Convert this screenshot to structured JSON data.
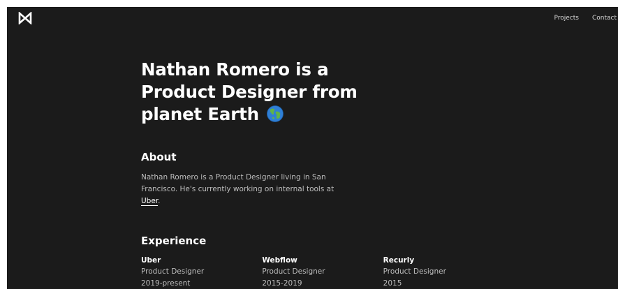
{
  "brand": {
    "logo_icon": "monogram-n-logo-icon"
  },
  "nav": {
    "items": [
      {
        "label": "Projects"
      },
      {
        "label": "Contact"
      }
    ]
  },
  "hero": {
    "headline": "Nathan Romero is a Product Designer from planet Earth",
    "emoji_icon": "globe-icon"
  },
  "about": {
    "title": "About",
    "text_before_link": "Nathan Romero is a Product Designer living in San Francisco. He's currently working on internal tools at ",
    "link_text": "Uber",
    "text_after_link": "."
  },
  "experience": {
    "title": "Experience",
    "jobs": [
      {
        "company": "Uber",
        "role": "Product Designer",
        "period": "2019-present"
      },
      {
        "company": "Webflow",
        "role": "Product Designer",
        "period": "2015-2019"
      },
      {
        "company": "Recurly",
        "role": "Product Designer",
        "period": "2015"
      }
    ]
  },
  "colors": {
    "background": "#1b1b1b",
    "text_primary": "#ffffff",
    "text_secondary": "#bdbdbd"
  }
}
